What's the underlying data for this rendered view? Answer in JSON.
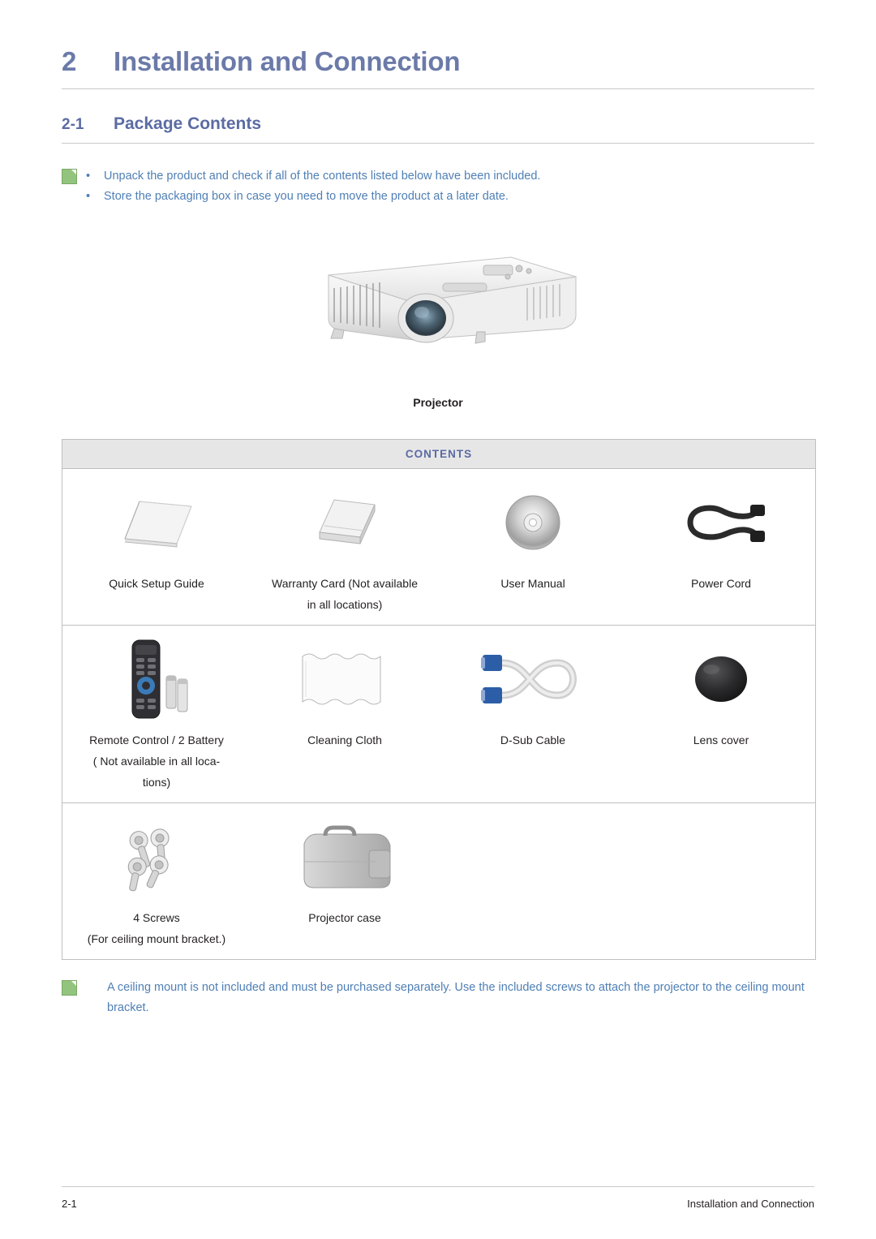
{
  "chapter": {
    "number": "2",
    "title": "Installation and Connection"
  },
  "section": {
    "number": "2-1",
    "title": "Package Contents"
  },
  "top_note": {
    "icon": "note-icon",
    "bullet": "•",
    "lines": [
      "Unpack the product and check if all of the contents listed below have been included.",
      "Store the packaging box in case you need to move the product at a later date."
    ]
  },
  "hero": {
    "alt": "projector-illustration",
    "caption": "Projector"
  },
  "contents_table": {
    "header": "CONTENTS",
    "rows": [
      [
        {
          "icon": "quick-setup-guide-icon",
          "label": "Quick Setup Guide",
          "sub": ""
        },
        {
          "icon": "warranty-card-icon",
          "label": "Warranty Card (Not available",
          "sub": "in all locations)"
        },
        {
          "icon": "user-manual-cd-icon",
          "label": "User Manual",
          "sub": ""
        },
        {
          "icon": "power-cord-icon",
          "label": "Power Cord",
          "sub": ""
        }
      ],
      [
        {
          "icon": "remote-control-icon",
          "label": "Remote Control / 2 Battery",
          "sub": "( Not available in all loca-",
          "sub2": "tions)"
        },
        {
          "icon": "cleaning-cloth-icon",
          "label": "Cleaning Cloth",
          "sub": ""
        },
        {
          "icon": "d-sub-cable-icon",
          "label": "D-Sub Cable",
          "sub": ""
        },
        {
          "icon": "lens-cover-icon",
          "label": "Lens cover",
          "sub": ""
        }
      ],
      [
        {
          "icon": "screws-icon",
          "label": "4 Screws",
          "sub": "(For ceiling mount bracket.)"
        },
        {
          "icon": "projector-case-icon",
          "label": "Projector case",
          "sub": ""
        }
      ]
    ]
  },
  "bottom_note": {
    "icon": "note-icon",
    "text": "A ceiling mount is not included and must be purchased separately. Use the included screws to attach the projector to the ceiling mount bracket."
  },
  "footer": {
    "page": "2-1",
    "title": "Installation and Connection"
  },
  "colors": {
    "heading_blue": "#6b7aa8",
    "note_blue": "#4f7fb5",
    "header_bg": "#e6e6e6",
    "rule": "#c9c9c9"
  }
}
